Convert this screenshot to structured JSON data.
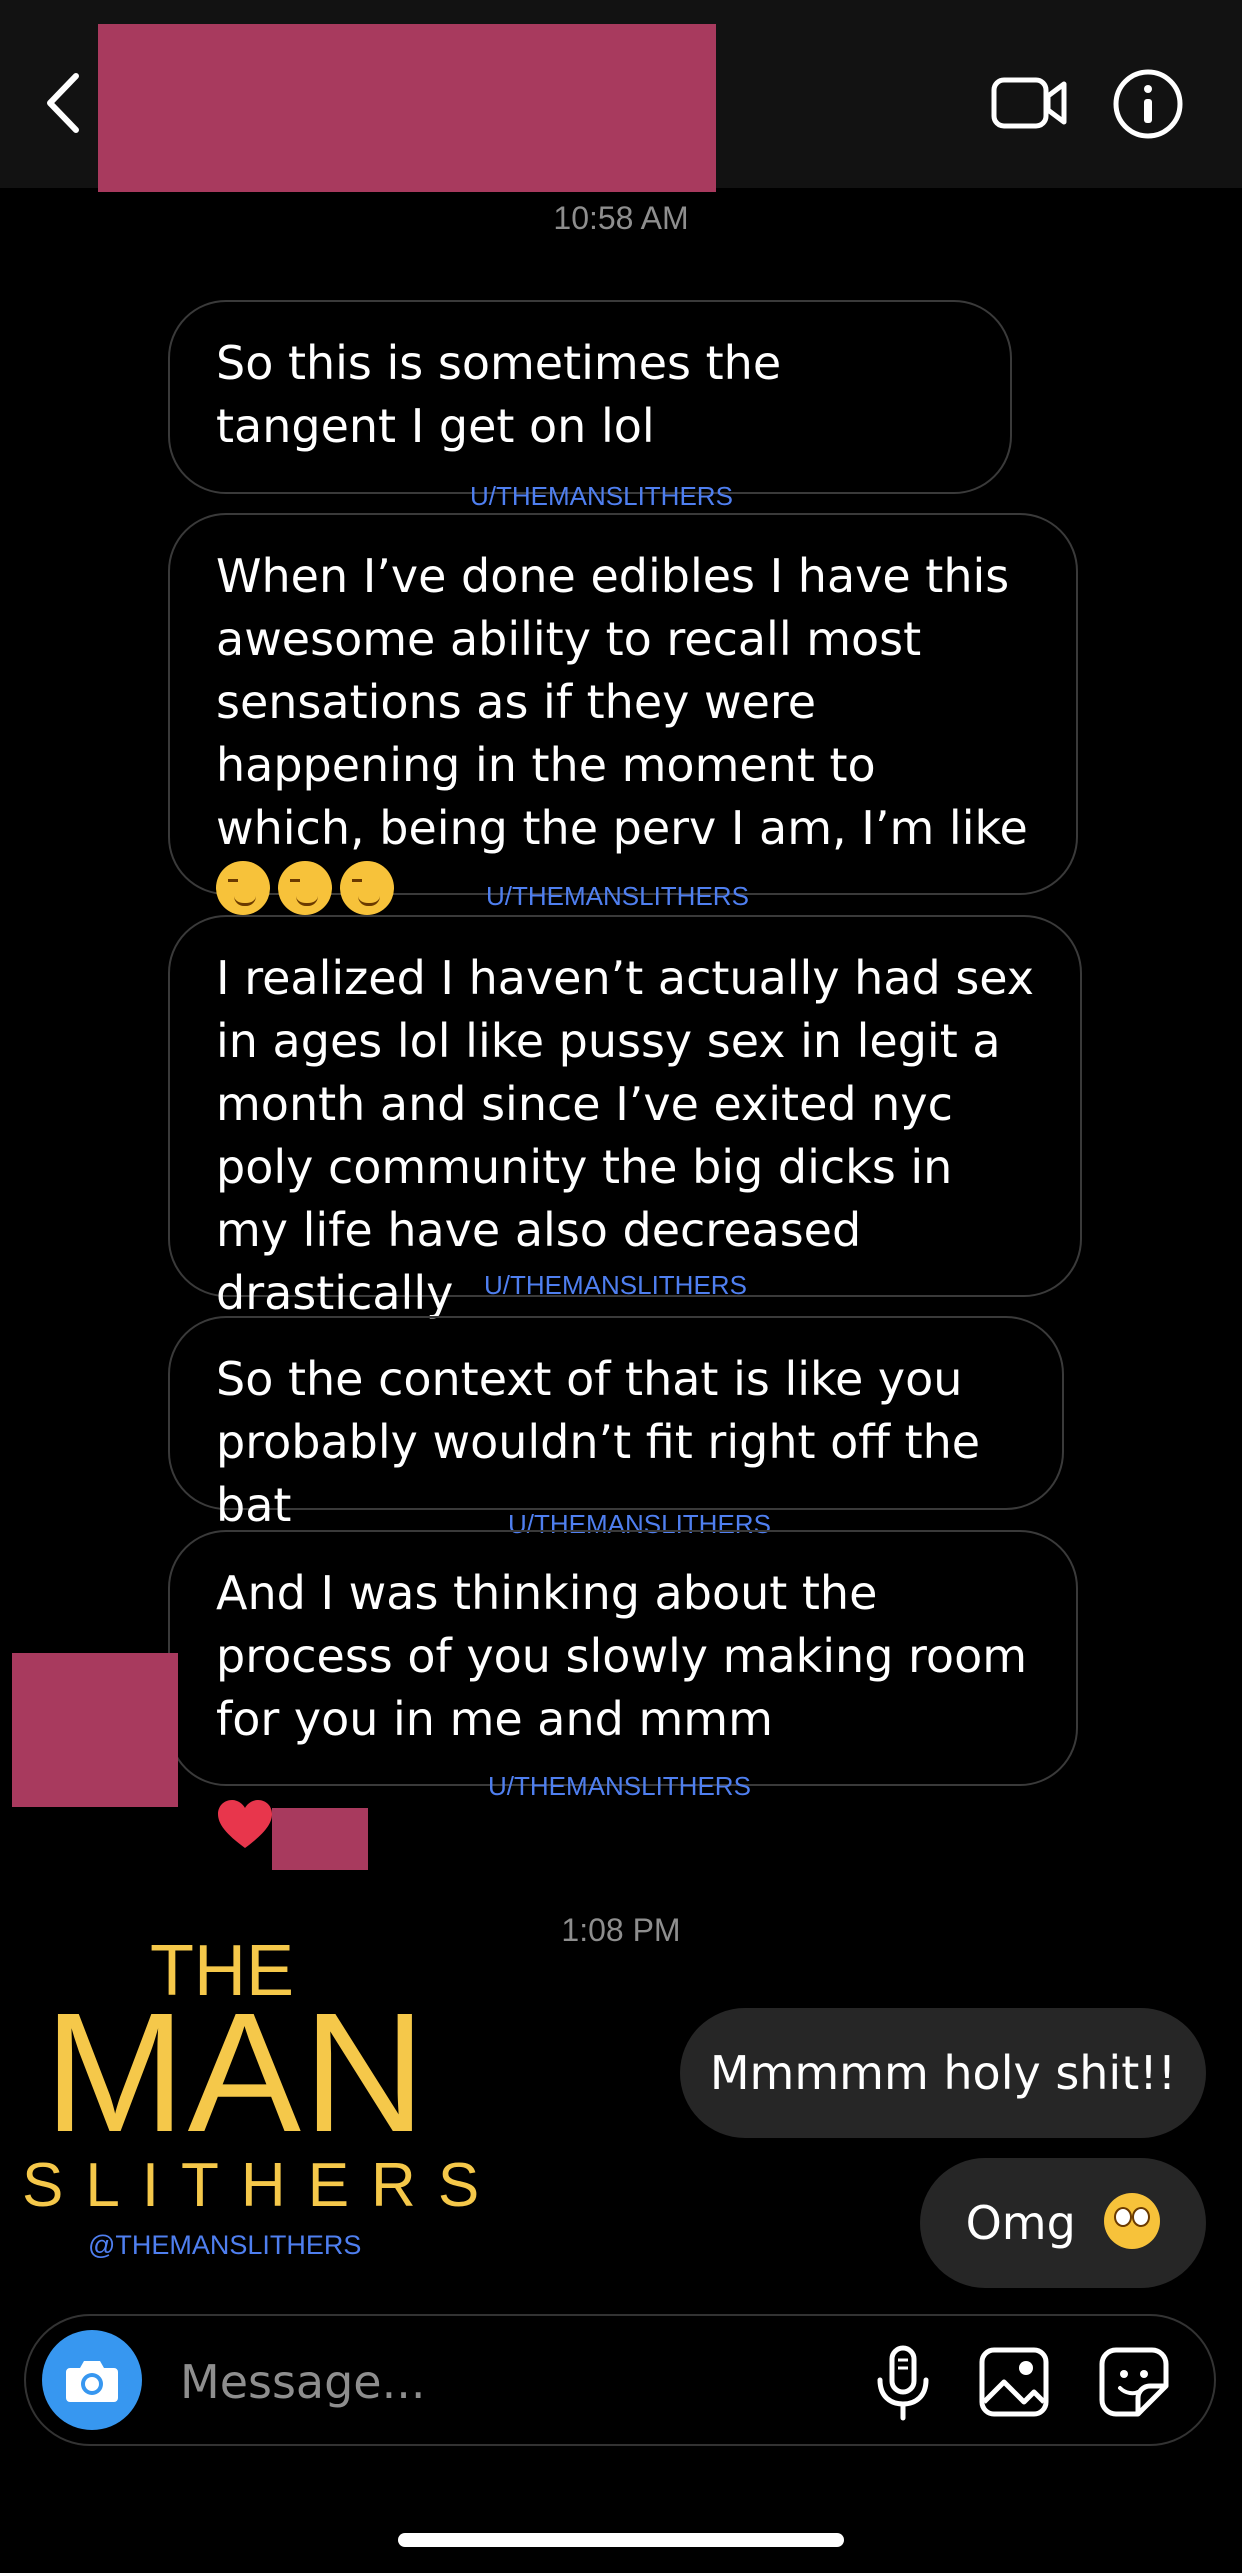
{
  "header": {
    "icons": {
      "back": "chevron-left-icon",
      "video": "video-call-icon",
      "info": "info-icon"
    }
  },
  "conversation": {
    "timestamp_1": "10:58 AM",
    "incoming_messages": [
      {
        "text": "So this is sometimes the tangent I get on lol",
        "watermark": "U/THEMANSLITHERS"
      },
      {
        "text": "When I’ve done edibles I have this awesome ability to recall most sensations as if they were happening in the moment to which, being the perv I am, I’m like",
        "watermark": "U/THEMANSLITHERS",
        "emoji": "smirking-face x3"
      },
      {
        "text": "I realized I haven’t actually had sex in ages lol like pussy sex in legit a month and since I’ve exited nyc poly community the big dicks in my life have also decreased drastically",
        "watermark": "U/THEMANSLITHERS"
      },
      {
        "text": "So the context of that is like you probably wouldn’t fit right off the bat",
        "watermark": "U/THEMANSLITHERS"
      },
      {
        "text": "And I was thinking about the process of you slowly making room for you in me and mmm",
        "watermark": "U/THEMANSLITHERS"
      }
    ],
    "reaction": "heart-icon",
    "timestamp_2": "1:08 PM",
    "outgoing_messages": [
      {
        "text": "Mmmmm holy shit!!"
      },
      {
        "text": "Omg",
        "emoji": "flushed-face"
      }
    ]
  },
  "watermark_logo": {
    "line1": "THE",
    "line2": "MAN",
    "line3": "SLITHERS",
    "handle": "@THEMANSLITHERS"
  },
  "composer": {
    "placeholder": "Message...",
    "icons": {
      "camera": "camera-icon",
      "mic": "microphone-icon",
      "gallery": "gallery-icon",
      "sticker": "sticker-icon"
    }
  },
  "colors": {
    "background": "#000000",
    "header": "#121212",
    "redaction": "#A83A5E",
    "watermark_blue": "#4F7FF0",
    "logo_gold": "#F5C84A",
    "outgoing_bubble": "#262626",
    "camera_button": "#3797F0"
  }
}
